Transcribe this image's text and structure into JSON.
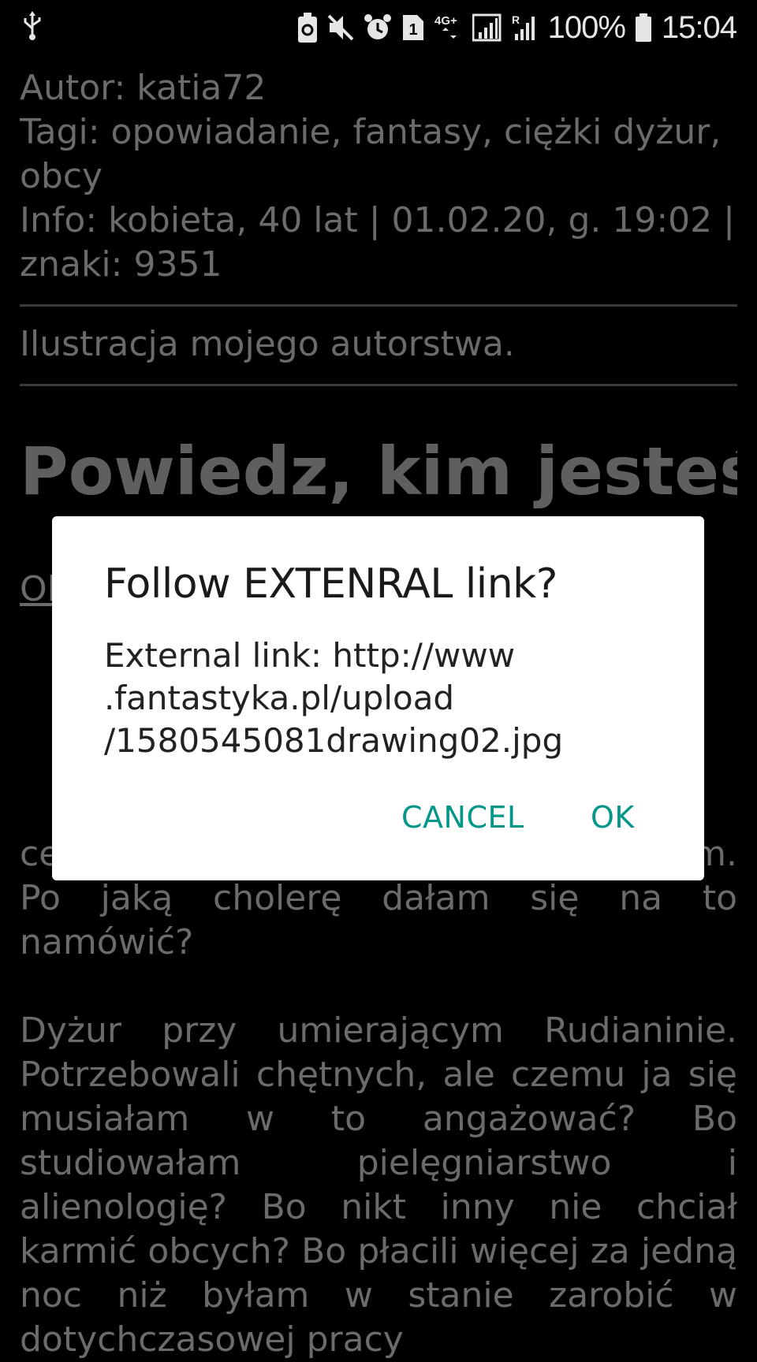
{
  "status_bar": {
    "battery_percent": "100%",
    "time": "15:04",
    "sim_slot": "1",
    "network_type": "4G+",
    "roaming": "R",
    "icons": [
      "usb-icon",
      "battery-saver-icon",
      "mute-icon",
      "alarm-icon",
      "sim-icon",
      "network-icon",
      "signal-icon",
      "roaming-signal-icon",
      "battery-icon"
    ]
  },
  "article": {
    "meta": [
      "Autor: katia72",
      "Tagi: opowiadanie, fantasy, ciężki dyżur,",
      "obcy",
      "Info: kobieta, 40 lat | 01.02.20, g. 19:02 |",
      "znaki: 9351"
    ],
    "illustration_note": "Ilustracja mojego autorstwa.",
    "title": "Powiedz, kim jesteś",
    "paragraph1_lead": "Ol",
    "paragraph1_tail": "centymetry przed dziurą. Westchnęłam. Po jaką cholerę dałam się na to namówić?",
    "paragraph2": "Dyżur przy umierającym Rudianinie. Potrzebowali chętnych, ale czemu ja się musiałam w to angażować? Bo studiowałam pielęgniarstwo i alienologię? Bo nikt inny nie chciał karmić obcych? Bo płacili więcej za jedną noc niż byłam w stanie zarobić w dotychczasowej pracy"
  },
  "dialog": {
    "title": "Follow EXTENRAL link?",
    "message_lines": [
      "External link: http://www",
      ".fantastyka.pl/upload",
      "/1580545081drawing02.jpg"
    ],
    "cancel_label": "CANCEL",
    "ok_label": "OK",
    "accent_color": "#009688"
  }
}
